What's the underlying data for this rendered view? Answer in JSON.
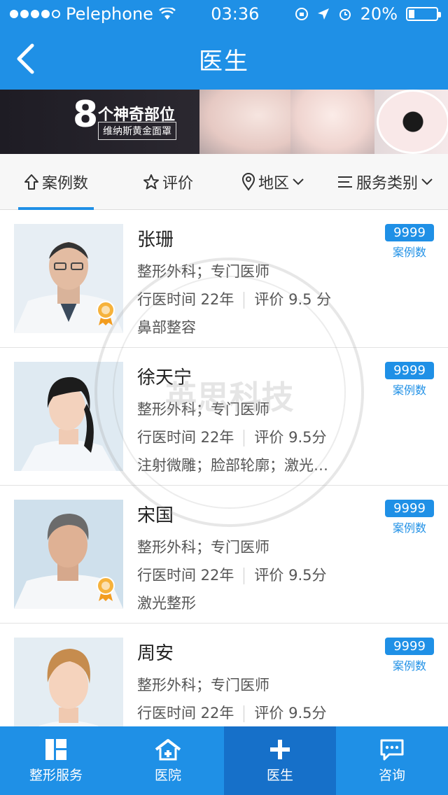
{
  "status": {
    "carrier": "Pelephone",
    "time": "03:36",
    "battery": "20%"
  },
  "nav": {
    "title": "医生"
  },
  "banner": {
    "big": "8",
    "line1": "个神奇部位",
    "line2": "维纳斯黄金面罩"
  },
  "tabs": [
    {
      "label": "案例数",
      "icon": "sort-up-icon",
      "active": true
    },
    {
      "label": "评价",
      "icon": "star-icon"
    },
    {
      "label": "地区",
      "icon": "location-pin-icon"
    },
    {
      "label": "服务类别",
      "icon": "list-icon"
    }
  ],
  "doctors": [
    {
      "name": "张珊",
      "title": "整形外科；专门医师",
      "years": "行医时间 22年",
      "rating": "评价 9.5 分",
      "specialty": "鼻部整容",
      "count": "9999",
      "count_label": "案例数"
    },
    {
      "name": "徐天宁",
      "title": "整形外科；专门医师",
      "years": "行医时间 22年",
      "rating": "评价 9.5分",
      "specialty": "注射微雕；脸部轮廓；激光…",
      "count": "9999",
      "count_label": "案例数"
    },
    {
      "name": "宋国",
      "title": "整形外科；专门医师",
      "years": "行医时间 22年",
      "rating": "评价 9.5分",
      "specialty": "激光整形",
      "count": "9999",
      "count_label": "案例数"
    },
    {
      "name": "周安",
      "title": "整形外科；专门医师",
      "years": "行医时间 22年",
      "rating": "评价 9.5分",
      "specialty": "",
      "count": "9999",
      "count_label": "案例数"
    }
  ],
  "watermark": {
    "text": "英思科技"
  },
  "bottom_nav": [
    {
      "label": "整形服务",
      "icon": "grid-icon"
    },
    {
      "label": "医院",
      "icon": "hospital-icon"
    },
    {
      "label": "医生",
      "icon": "plus-icon",
      "active": true
    },
    {
      "label": "咨询",
      "icon": "chat-icon"
    }
  ],
  "colors": {
    "primary": "#1f90e6",
    "active_nav": "#1670c9"
  }
}
